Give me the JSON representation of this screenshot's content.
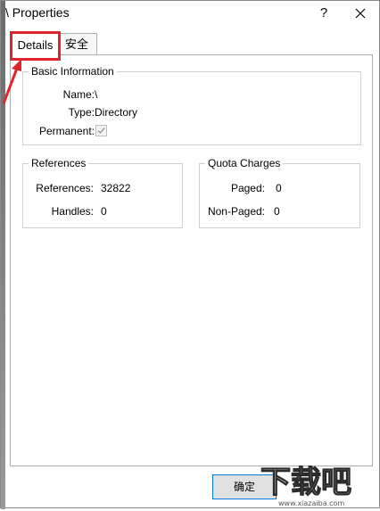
{
  "window": {
    "title": "\\ Properties",
    "help_label": "?"
  },
  "tabs": [
    {
      "label": "Details"
    },
    {
      "label": "安全"
    }
  ],
  "basic_information": {
    "legend": "Basic Information",
    "name_label": "Name:",
    "name_value": "\\",
    "type_label": "Type:",
    "type_value": "Directory",
    "permanent_label": "Permanent:",
    "permanent_checked": true
  },
  "references": {
    "legend": "References",
    "references_label": "References:",
    "references_value": "32822",
    "handles_label": "Handles:",
    "handles_value": "0"
  },
  "quota_charges": {
    "legend": "Quota Charges",
    "paged_label": "Paged:",
    "paged_value": "0",
    "nonpaged_label": "Non-Paged:",
    "nonpaged_value": "0"
  },
  "footer": {
    "ok_label": "确定"
  },
  "watermark": {
    "text": "下载吧",
    "url": "www.xiazaiba.com"
  },
  "colors": {
    "annotation": "#e0242b",
    "accent": "#0078d7"
  }
}
